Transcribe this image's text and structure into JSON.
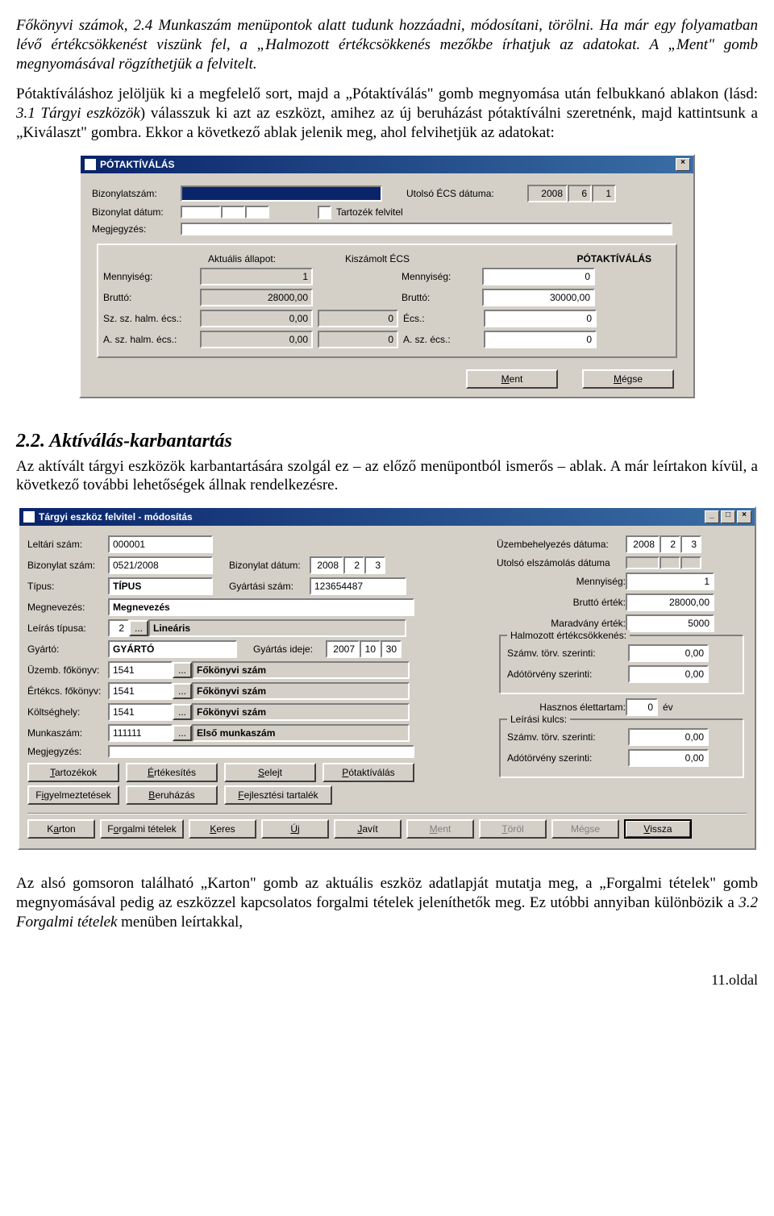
{
  "doc": {
    "p1": "Főkönyvi számok, 2.4 Munkaszám menüpontok alatt tudunk hozzáadni, módosítani, törölni. Ha már egy folyamatban lévő értékcsökkenést viszünk fel, a „Halmozott értékcsökkenés mezőkbe írhatjuk az adatokat. A „Ment\" gomb megnyomásával rögzíthetjük a felvitelt.",
    "p2a": "Pótaktíváláshoz jelöljük ki a megfelelő sort, majd a „Pótaktíválás\" gomb megnyomása után felbukkanó ablakon (lásd: ",
    "p2i": "3.1 Tárgyi eszközök",
    "p2b": ") válasszuk ki azt az eszközt, amihez az új beruházást pótaktíválni szeretnénk, majd kattintsunk a „Kiválaszt\" gombra. Ekkor a következő ablak jelenik meg, ahol felvihetjük az adatokat:",
    "sec": "2.2. Aktíválás-karbantartás",
    "p3": "Az aktívált tárgyi eszközök karbantartására szolgál ez – az előző menüpontból ismerős – ablak. A már leírtakon kívül, a következő további lehetőségek állnak rendelkezésre.",
    "p4a": "Az alsó gomsoron található „Karton\" gomb az aktuális eszköz adatlapját mutatja meg, a „Forgalmi tételek\" gomb megnyomásával pedig az eszközzel kapcsolatos forgalmi tételek jeleníthetők meg. Ez utóbbi annyiban különbözik a ",
    "p4i": "3.2 Forgalmi tételek",
    "p4b": " menüben leírtakkal,",
    "footer": "11.oldal"
  },
  "win1": {
    "title": "PÓTAKTÍVÁLÁS",
    "close": "×",
    "labels": {
      "bizonylat": "Bizonylatszám:",
      "utolso": "Utolsó ÉCS dátuma:",
      "bizdatum": "Bizonylat dátum:",
      "tartozek": "Tartozék felvitel",
      "megj": "Megjegyzés:",
      "aktualis": "Aktuális állapot:",
      "kiszamolt": "Kiszámolt ÉCS",
      "pot": "PÓTAKTÍVÁLÁS",
      "menny": "Mennyiség:",
      "brutto": "Bruttó:",
      "szhalm": "Sz. sz. halm. écs.:",
      "ahalm": "A. sz. halm. écs.:",
      "ecs": "Écs.:",
      "aecs": "A. sz. écs.:"
    },
    "vals": {
      "y": "2008",
      "m": "6",
      "d": "1",
      "menny1": "1",
      "menny2": "0",
      "brutto1": "28000,00",
      "brutto2": "30000,00",
      "sz1": "0,00",
      "sz2": "0",
      "ecs": "0",
      "a1": "0,00",
      "a2": "0",
      "aecs": "0"
    },
    "btns": {
      "ment": "Ment",
      "megse": "Mégse",
      "mentU": "M",
      "megseU": "M"
    }
  },
  "win2": {
    "title": "Tárgyi eszköz felvitel - módosítás",
    "labels": {
      "leltari": "Leltári szám:",
      "bizsz": "Bizonylat szám:",
      "tipus": "Típus:",
      "megnev": "Megnevezés:",
      "leiras": "Leírás típusa:",
      "gyarto": "Gyártó:",
      "uzemb": "Üzemb. főkönyv:",
      "ertekcs": "Értékcs. főkönyv:",
      "koltseg": "Költséghely:",
      "munka": "Munkaszám:",
      "megj": "Megjegyzés:",
      "bizdat": "Bizonylat dátum:",
      "gyartsz": "Gyártási szám:",
      "gyartid": "Gyártás ideje:",
      "uzdat": "Üzembehelyezés dátuma:",
      "utolels": "Utolsó elszámolás dátuma",
      "menny": "Mennyiség:",
      "brutto": "Bruttó érték:",
      "maradv": "Maradvány érték:",
      "halm": "Halmozott értékcsökkenés:",
      "szamv": "Számv. törv. szerinti:",
      "ado": "Adótörvény szerinti:",
      "haszn": "Hasznos élettartam:",
      "ev": "év",
      "leirkulcs": "Leírási kulcs:"
    },
    "vals": {
      "leltari": "000001",
      "bizsz": "0521/2008",
      "tipus": "TÍPUS",
      "megnev": "Megnevezés",
      "leiras_n": "2",
      "leiras_t": "Lineáris",
      "gyarto": "GYÁRTÓ",
      "fk": "Főkönyvi szám",
      "fk_num": "1541",
      "elso": "Első munkaszám",
      "munka": "111111",
      "bizdat_y": "2008",
      "bizdat_m": "2",
      "bizdat_d": "3",
      "gyartsz": "123654487",
      "gyart_y": "2007",
      "gyart_m": "10",
      "gyart_d": "30",
      "uz_y": "2008",
      "uz_m": "2",
      "uz_d": "3",
      "menny": "1",
      "brutto": "28000,00",
      "maradv": "5000",
      "szamv": "0,00",
      "ado": "0,00",
      "haszn": "0",
      "kulcs_sz": "0,00",
      "kulcs_ado": "0,00"
    },
    "btns1": {
      "tartozek": "Tartozékok",
      "ertek": "Értékesítés",
      "selejt": "Selejt",
      "pot": "Pótaktíválás",
      "figy": "Figyelmeztetések",
      "beruh": "Beruházás",
      "fejl": "Fejlesztési tartalék"
    },
    "btns2": {
      "karton": "Karton",
      "forg": "Forgalmi tételek",
      "keres": "Keres",
      "uj": "Új",
      "javit": "Javít",
      "ment": "Ment",
      "torol": "Töröl",
      "megse": "Mégse",
      "vissza": "Vissza"
    }
  }
}
